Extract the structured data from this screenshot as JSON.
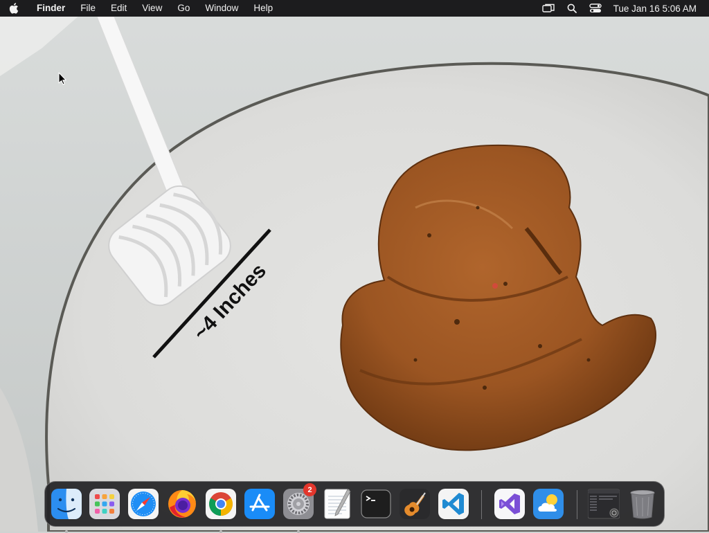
{
  "menubar": {
    "app_name": "Finder",
    "menus": [
      "File",
      "Edit",
      "View",
      "Go",
      "Window",
      "Help"
    ],
    "status_icons": [
      "screen-mirroring-icon",
      "spotlight-search-icon",
      "control-center-icon"
    ],
    "clock": "Tue Jan 16  5:06 AM"
  },
  "wallpaper": {
    "annotation": "~4 Inches"
  },
  "dock": {
    "apps": [
      {
        "name": "Finder",
        "icon": "finder-icon",
        "running": true
      },
      {
        "name": "Launchpad",
        "icon": "launchpad-icon",
        "running": false
      },
      {
        "name": "Safari",
        "icon": "safari-icon",
        "running": false
      },
      {
        "name": "Firefox",
        "icon": "firefox-icon",
        "running": false
      },
      {
        "name": "Google Chrome",
        "icon": "chrome-icon",
        "running": true
      },
      {
        "name": "App Store",
        "icon": "app-store-icon",
        "running": false
      },
      {
        "name": "System Settings",
        "icon": "system-settings-icon",
        "running": true,
        "badge": "2"
      },
      {
        "name": "TextEdit",
        "icon": "textedit-icon",
        "running": false
      },
      {
        "name": "Terminal",
        "icon": "terminal-icon",
        "running": false
      },
      {
        "name": "GarageBand",
        "icon": "garageband-icon",
        "running": false
      },
      {
        "name": "Visual Studio Code",
        "icon": "vscode-icon",
        "running": false
      },
      {
        "name": "Visual Studio",
        "icon": "visual-studio-icon",
        "running": false
      },
      {
        "name": "Weather",
        "icon": "weather-icon",
        "running": false
      },
      {
        "name": "Recent Window",
        "icon": "window-preview-icon",
        "running": false
      },
      {
        "name": "Trash",
        "icon": "trash-icon",
        "running": false
      }
    ]
  },
  "colors": {
    "menubar_bg": "#1c1c1e",
    "dock_bg": "#242426",
    "badge": "#e3362c"
  }
}
